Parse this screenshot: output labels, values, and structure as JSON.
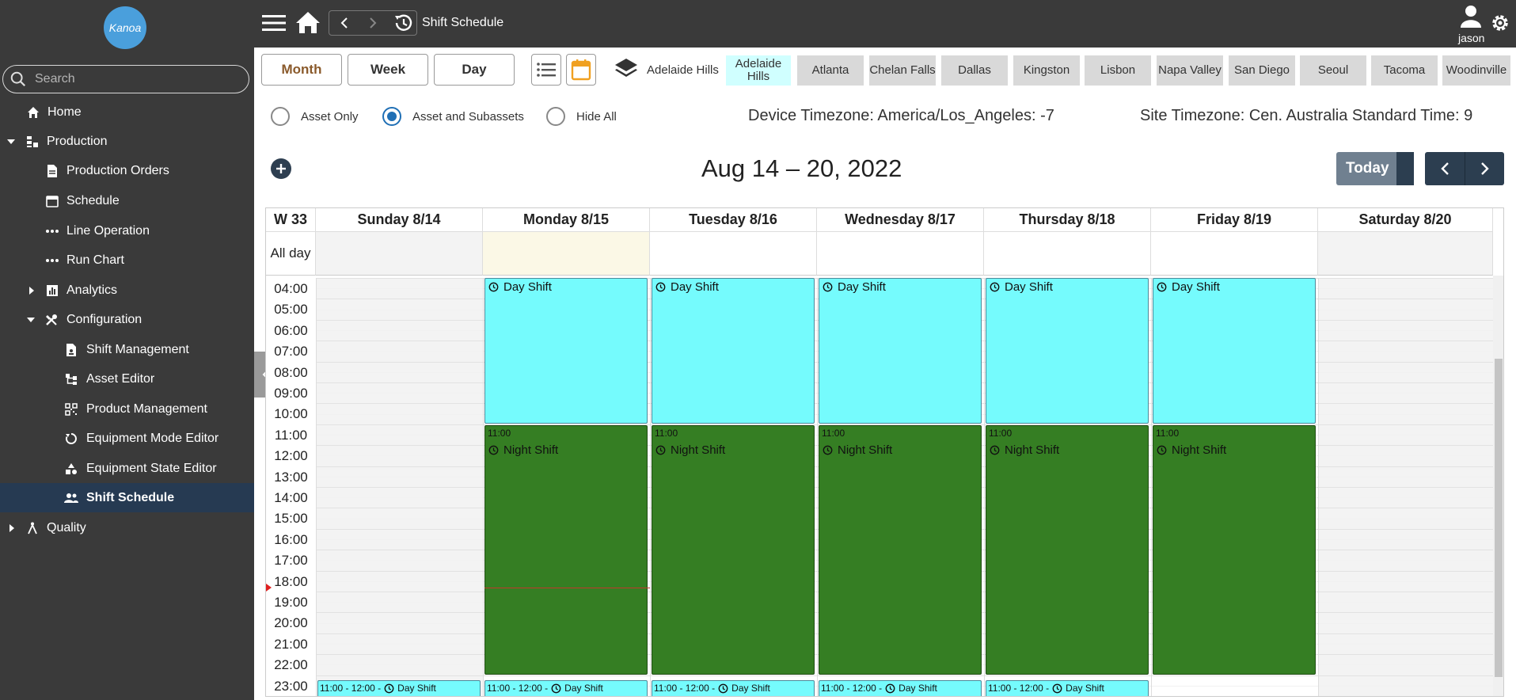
{
  "sidebar": {
    "logo_text": "Kanoa",
    "search_placeholder": "Search",
    "items": [
      {
        "label": "Home",
        "icon": "home-icon"
      },
      {
        "label": "Production",
        "icon": "production-icon"
      },
      {
        "label": "Production Orders",
        "icon": "document-icon"
      },
      {
        "label": "Schedule",
        "icon": "calendar-icon"
      },
      {
        "label": "Line Operation",
        "icon": "dots-icon"
      },
      {
        "label": "Run Chart",
        "icon": "dots-icon"
      },
      {
        "label": "Analytics",
        "icon": "bar-chart-icon"
      },
      {
        "label": "Configuration",
        "icon": "tools-icon"
      },
      {
        "label": "Shift Management",
        "icon": "badge-document-icon"
      },
      {
        "label": "Asset Editor",
        "icon": "tree-icon"
      },
      {
        "label": "Product Management",
        "icon": "qr-icon"
      },
      {
        "label": "Equipment Mode Editor",
        "icon": "circle-arrows-icon"
      },
      {
        "label": "Equipment State Editor",
        "icon": "shapes-icon"
      },
      {
        "label": "Shift Schedule",
        "icon": "people-icon"
      },
      {
        "label": "Quality",
        "icon": "compass-icon"
      }
    ]
  },
  "topbar": {
    "title": "Shift Schedule",
    "user": "jason"
  },
  "toolbar": {
    "views": [
      "Month",
      "Week",
      "Day"
    ],
    "selected_view": "Month",
    "layers_label": "Adelaide Hills",
    "sites": [
      "Adelaide Hills",
      "Atlanta",
      "Chelan Falls",
      "Dallas",
      "Kingston",
      "Lisbon",
      "Napa Valley",
      "San Diego",
      "Seoul",
      "Tacoma",
      "Woodinville"
    ],
    "selected_site": "Adelaide Hills"
  },
  "filters": {
    "options": [
      "Asset Only",
      "Asset and Subassets",
      "Hide All"
    ],
    "selected": "Asset and Subassets",
    "device_tz": "Device Timezone: America/Los_Angeles: -7",
    "site_tz": "Site Timezone: Cen. Australia Standard Time: 9"
  },
  "calendar": {
    "range_title": "Aug 14 – 20, 2022",
    "today_label": "Today",
    "week_label": "W 33",
    "allday_label": "All day",
    "days": [
      "Sunday 8/14",
      "Monday 8/15",
      "Tuesday 8/16",
      "Wednesday 8/17",
      "Thursday 8/18",
      "Friday 8/19",
      "Saturday 8/20"
    ],
    "hours": [
      "04:00",
      "05:00",
      "06:00",
      "07:00",
      "08:00",
      "09:00",
      "10:00",
      "11:00",
      "12:00",
      "13:00",
      "14:00",
      "15:00",
      "16:00",
      "17:00",
      "18:00",
      "19:00",
      "20:00",
      "21:00",
      "22:00",
      "23:00"
    ],
    "day_shift_label": "Day Shift",
    "night_shift_label": "Night Shift",
    "night_start": "11:00",
    "bottom_time": "11:00 - 12:00 -",
    "colors": {
      "day_shift": "#75fbfd",
      "night_shift": "#357e23",
      "today_bg": "#fbf8e6",
      "weekend_bg": "#f3f3f3"
    }
  }
}
